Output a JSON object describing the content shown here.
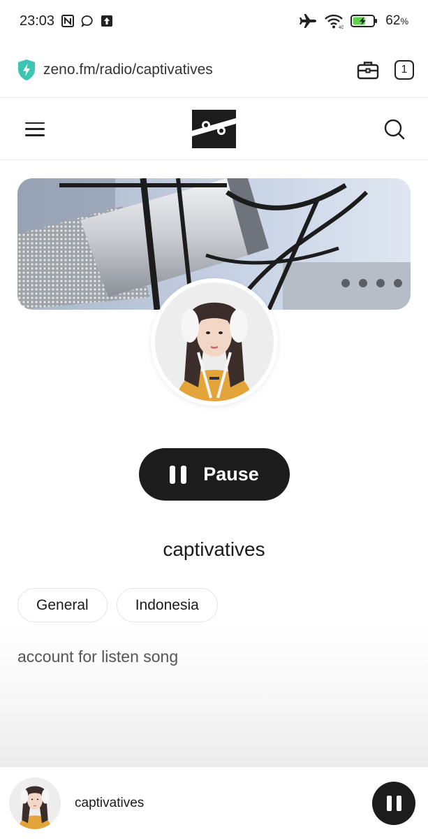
{
  "status_bar": {
    "time": "23:03",
    "battery_percent": "62",
    "battery_unit": "%",
    "battery_level": 0.62,
    "icons": [
      "nfc-icon",
      "chat-bubble-icon",
      "upload-icon",
      "airplane-mode-icon",
      "wifi-icon",
      "battery-charging-icon"
    ]
  },
  "browser": {
    "url": "zeno.fm/radio/captivatives",
    "tab_count": "1",
    "icons": [
      "secure-shield-icon",
      "briefcase-icon",
      "tabs-icon"
    ]
  },
  "site_header": {
    "icons": [
      "hamburger-menu-icon",
      "zeno-logo",
      "search-icon"
    ]
  },
  "player": {
    "pause_label": "Pause",
    "station_name": "captivatives",
    "tags": [
      "General",
      "Indonesia"
    ],
    "description": "account for listen song"
  },
  "mini_player": {
    "station_name": "captivatives"
  },
  "colors": {
    "shield": "#3cc4b4",
    "dark": "#1c1c1c",
    "battery_fill": "#5fd14b",
    "avatar_jacket": "#e3a53a",
    "banner_sky": "#c9d4e6"
  }
}
